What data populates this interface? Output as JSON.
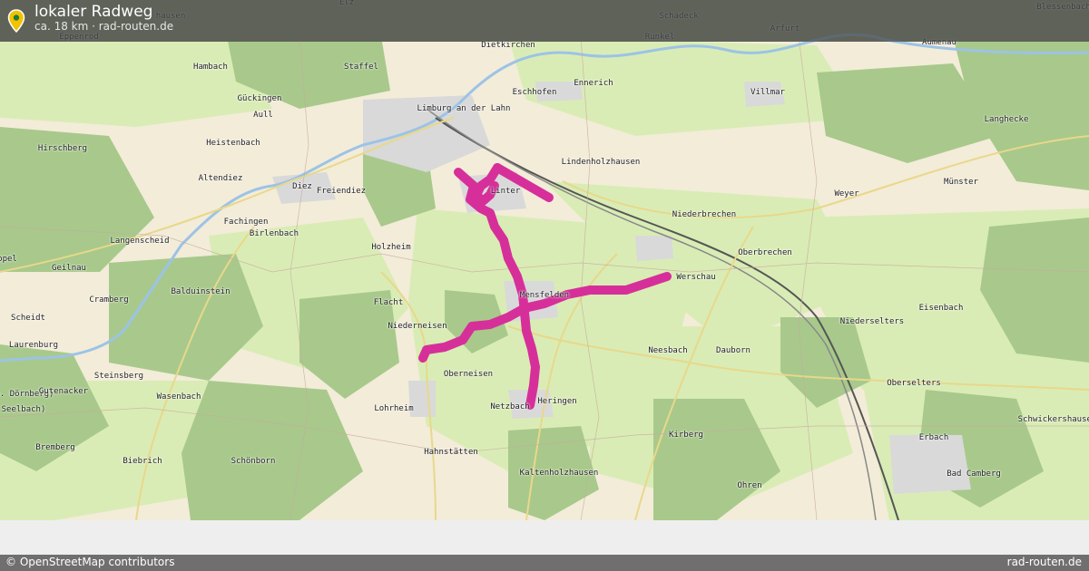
{
  "header": {
    "title": "lokaler Radweg",
    "subtitle": "ca. 18 km · rad-routen.de",
    "pin_icon": "map-pin-icon"
  },
  "map": {
    "route_color": "#d62f9a",
    "forest_color": "#a8c98b",
    "meadow_color": "#d8ecb4",
    "settlement_color": "#d9d9d9",
    "places": [
      {
        "name": "Elz"
      },
      {
        "name": "Schadeck"
      },
      {
        "name": "Blessenbach"
      },
      {
        "name": "hausen"
      },
      {
        "name": "Eppenrod"
      },
      {
        "name": "Dietkirchen"
      },
      {
        "name": "Runkel"
      },
      {
        "name": "Arfurt"
      },
      {
        "name": "Aumenau"
      },
      {
        "name": "Hambach"
      },
      {
        "name": "Staffel"
      },
      {
        "name": "Eschhofen"
      },
      {
        "name": "Ennerich"
      },
      {
        "name": "Villmar"
      },
      {
        "name": "Gückingen"
      },
      {
        "name": "Limburg an der Lahn"
      },
      {
        "name": "Aull"
      },
      {
        "name": "Langhecke"
      },
      {
        "name": "Heistenbach"
      },
      {
        "name": "Hirschberg"
      },
      {
        "name": "Lindenholzhausen"
      },
      {
        "name": "Altendiez"
      },
      {
        "name": "Diez"
      },
      {
        "name": "Freiendiez"
      },
      {
        "name": "Linter"
      },
      {
        "name": "Weyer"
      },
      {
        "name": "Münster"
      },
      {
        "name": "Fachingen"
      },
      {
        "name": "Niederbrechen"
      },
      {
        "name": "Birlenbach"
      },
      {
        "name": "Langenscheid"
      },
      {
        "name": "Holzheim"
      },
      {
        "name": "Oberbrechen"
      },
      {
        "name": "ppel"
      },
      {
        "name": "Geilnau"
      },
      {
        "name": "Werschau"
      },
      {
        "name": "Cramberg"
      },
      {
        "name": "Balduinstein"
      },
      {
        "name": "Mensfelden"
      },
      {
        "name": "Flacht"
      },
      {
        "name": "Eisenbach"
      },
      {
        "name": "Scheidt"
      },
      {
        "name": "Niederneisen"
      },
      {
        "name": "Niederselters"
      },
      {
        "name": "Laurenburg"
      },
      {
        "name": "Neesbach"
      },
      {
        "name": "Dauborn"
      },
      {
        "name": "Steinsberg"
      },
      {
        "name": "Oberneisen"
      },
      {
        "name": "Oberselters"
      },
      {
        "name": "n. Dörnberg)"
      },
      {
        "name": "Gutenacker"
      },
      {
        "name": "Wasenbach"
      },
      {
        "name": "Heringen"
      },
      {
        "name": "Seelbach)"
      },
      {
        "name": "Lohrheim"
      },
      {
        "name": "Netzbach"
      },
      {
        "name": "Schwickershausen"
      },
      {
        "name": "Kirberg"
      },
      {
        "name": "Erbach"
      },
      {
        "name": "Bremberg"
      },
      {
        "name": "Hahnstätten"
      },
      {
        "name": "Biebrich"
      },
      {
        "name": "Schönborn"
      },
      {
        "name": "Bad Camberg"
      },
      {
        "name": "Kaltenholzhausen"
      },
      {
        "name": "Ohren"
      }
    ]
  },
  "footer": {
    "attribution": "© OpenStreetMap contributors",
    "site": "rad-routen.de"
  }
}
